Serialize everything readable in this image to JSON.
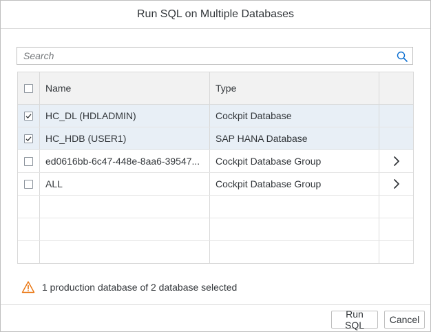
{
  "dialog": {
    "title": "Run SQL on Multiple Databases"
  },
  "search": {
    "placeholder": "Search",
    "value": "",
    "icon": "search-icon"
  },
  "table": {
    "columns": [
      "Name",
      "Type",
      ""
    ],
    "rows": [
      {
        "checked": true,
        "name": "HC_DL (HDLADMIN)",
        "type": "Cockpit Database",
        "navigable": false
      },
      {
        "checked": true,
        "name": "HC_HDB (USER1)",
        "type": "SAP HANA Database",
        "navigable": false
      },
      {
        "checked": false,
        "name": "ed0616bb-6c47-448e-8aa6-39547...",
        "type": "Cockpit Database Group",
        "navigable": true
      },
      {
        "checked": false,
        "name": "ALL",
        "type": "Cockpit Database Group",
        "navigable": true
      }
    ],
    "empty_rows": 3
  },
  "status": {
    "message": "1 production database of 2 database selected",
    "icon": "warning-icon",
    "icon_color": "#e9730c"
  },
  "footer": {
    "run_label": "Run SQL",
    "cancel_label": "Cancel"
  },
  "colors": {
    "selected_row": "#e8eff6",
    "header_row": "#f2f2f2",
    "border": "#d9d9d9",
    "text": "#32363a"
  }
}
